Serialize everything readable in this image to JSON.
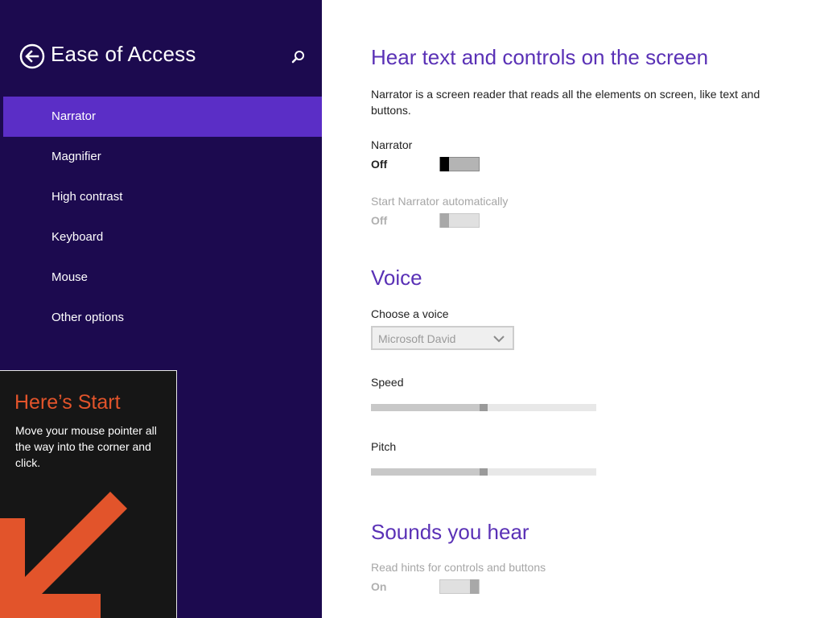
{
  "sidebar": {
    "title": "Ease of Access",
    "items": [
      {
        "label": "Narrator",
        "selected": true
      },
      {
        "label": "Magnifier"
      },
      {
        "label": "High contrast"
      },
      {
        "label": "Keyboard"
      },
      {
        "label": "Mouse"
      },
      {
        "label": "Other options"
      }
    ]
  },
  "start_tip": {
    "title": "Here’s Start",
    "body": "Move your mouse pointer all the way into the corner and click."
  },
  "main": {
    "section1_title": "Hear text and controls on the screen",
    "description": "Narrator is a screen reader that reads all the elements on screen, like text and buttons.",
    "narrator": {
      "label": "Narrator",
      "state": "Off"
    },
    "start_narrator": {
      "label": "Start Narrator automatically",
      "state": "Off"
    },
    "voice_title": "Voice",
    "choose_voice_label": "Choose a voice",
    "voice_value": "Microsoft David",
    "speed": {
      "label": "Speed",
      "level": 0.5
    },
    "pitch": {
      "label": "Pitch",
      "level": 0.5
    },
    "sounds_title": "Sounds you hear",
    "read_hints": {
      "label": "Read hints for controls and buttons",
      "state": "On"
    }
  },
  "colors": {
    "sidebar_bg": "#1c0a4f",
    "selected_item": "#5b2ec6",
    "heading": "#5a31b6",
    "tip_title": "#e2542b"
  }
}
